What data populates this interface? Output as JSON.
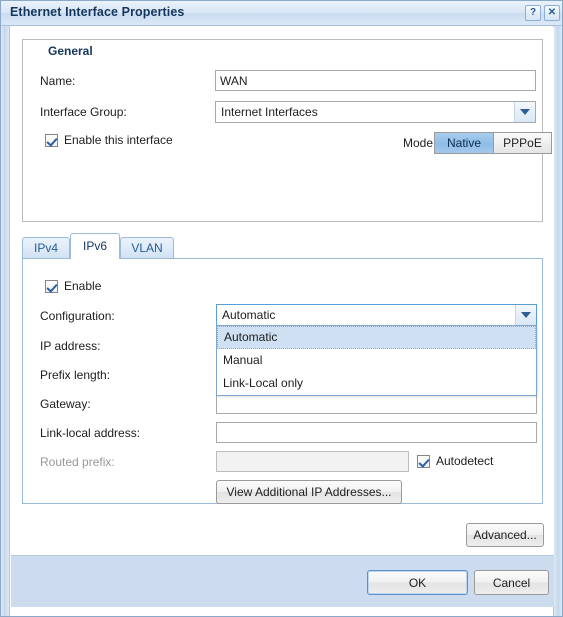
{
  "window": {
    "title": "Ethernet Interface Properties",
    "help_button": "?",
    "close_button": "✕"
  },
  "general": {
    "legend": "General",
    "name_label": "Name:",
    "name_value": "WAN",
    "interface_group_label": "Interface Group:",
    "interface_group_value": "Internet Interfaces",
    "enable_interface_label": "Enable this interface",
    "mode_label": "Mode:",
    "mode_options": [
      "Native",
      "PPPoE"
    ],
    "mode_selected": "Native"
  },
  "tabs": [
    {
      "label": "IPv4",
      "active": false
    },
    {
      "label": "IPv6",
      "active": true
    },
    {
      "label": "VLAN",
      "active": false
    }
  ],
  "ipv6": {
    "enable_label": "Enable",
    "configuration_label": "Configuration:",
    "configuration_value": "Automatic",
    "configuration_options": [
      "Automatic",
      "Manual",
      "Link-Local only"
    ],
    "configuration_highlighted": "Automatic",
    "ip_address_label": "IP address:",
    "ip_address_value": "",
    "prefix_length_label": "Prefix length:",
    "prefix_length_value": "",
    "gateway_label": "Gateway:",
    "gateway_value": "",
    "link_local_address_label": "Link-local address:",
    "link_local_address_value": "",
    "routed_prefix_label": "Routed prefix:",
    "routed_prefix_value": "",
    "autodetect_label": "Autodetect",
    "view_additional_button": "View Additional IP Addresses..."
  },
  "advanced_button": "Advanced...",
  "footer": {
    "ok_button": "OK",
    "cancel_button": "Cancel"
  },
  "colors": {
    "titlebar_text": "#14365c",
    "accent_blue": "#8fbce6",
    "footer_bg": "#ccdcee",
    "selection_bg": "#cfe0f2"
  }
}
